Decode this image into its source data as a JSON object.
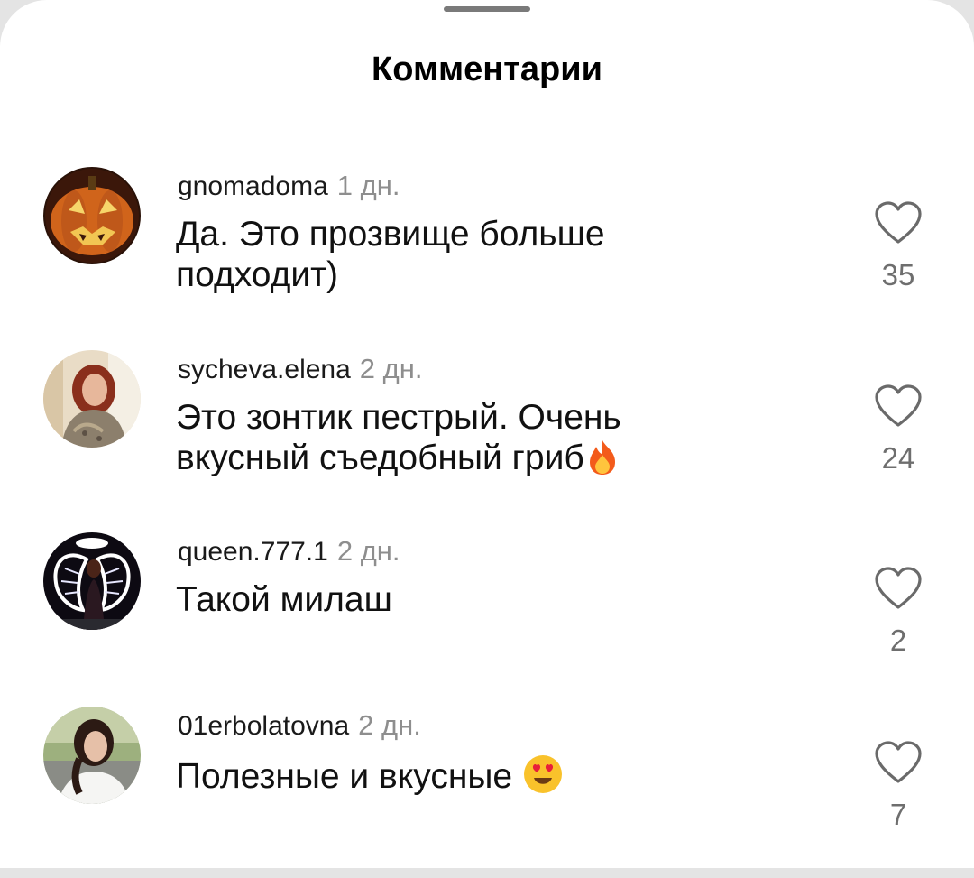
{
  "sheet": {
    "title": "Комментарии"
  },
  "comments": [
    {
      "username": "gnomadoma",
      "time": "1 дн.",
      "text": "Да. Это прозвище больше подходит)",
      "likes": "35",
      "avatar": "pumpkin-avatar"
    },
    {
      "username": "sycheva.elena",
      "time": "2 дн.",
      "text": "Это зонтик пестрый. Очень вкусный съедобный гриб",
      "emoji": "fire-emoji",
      "likes": "24",
      "avatar": "woman-avatar"
    },
    {
      "username": "queen.777.1",
      "time": "2 дн.",
      "text": "Такой милаш",
      "likes": "2",
      "avatar": "angel-wings-avatar"
    },
    {
      "username": "01erbolatovna",
      "time": "2 дн.",
      "text": "Полезные и вкусные",
      "emoji": "heart-eyes-emoji",
      "likes": "7",
      "avatar": "girl-avatar"
    }
  ],
  "colors": {
    "background": "#ffffff",
    "secondary_text": "#8e8e8e",
    "count_text": "#6e6e6e",
    "handle": "#7a7a7a"
  }
}
